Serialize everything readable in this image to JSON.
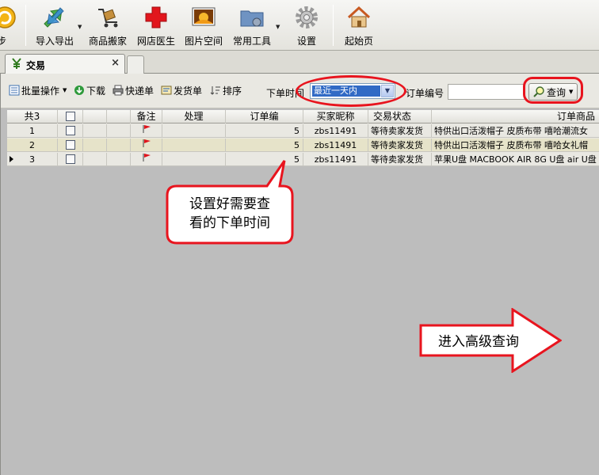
{
  "toolbar": {
    "items": [
      {
        "label": "步",
        "icon": "sync-icon"
      },
      {
        "label": "导入导出",
        "icon": "import-export-icon"
      },
      {
        "label": "商品搬家",
        "icon": "move-goods-icon"
      },
      {
        "label": "网店医生",
        "icon": "shop-doctor-icon"
      },
      {
        "label": "图片空间",
        "icon": "image-space-icon"
      },
      {
        "label": "常用工具",
        "icon": "tools-folder-icon"
      },
      {
        "label": "设置",
        "icon": "settings-gear-icon"
      },
      {
        "label": "起始页",
        "icon": "home-icon"
      }
    ]
  },
  "tabs": {
    "active": {
      "label": "交易",
      "close": "×",
      "icon": "trade-icon"
    }
  },
  "subtoolbar": {
    "batch": "批量操作",
    "download": "下载",
    "express": "快递单",
    "ship": "发货单",
    "sort": "排序",
    "time_label": "下单时间",
    "time_value": "最近一天内",
    "order_no_label": "订单编号",
    "query": "查询"
  },
  "table": {
    "headers": {
      "count": "共3",
      "note": "备注",
      "handle": "处理",
      "order": "订单编",
      "buyer": "买家昵称",
      "status": "交易状态",
      "goods": "订单商品"
    },
    "rows": [
      {
        "num": "1",
        "order_tail": "5",
        "buyer": "zbs11491",
        "status": "等待卖家发货",
        "goods": "特供出口活泼帽子 皮质布带 嘻哈潮流女"
      },
      {
        "num": "2",
        "order_tail": "5",
        "buyer": "zbs11491",
        "status": "等待卖家发货",
        "goods": "特供出口活泼帽子 皮质布带 嘻哈女礼帽"
      },
      {
        "num": "3",
        "order_tail": "5",
        "buyer": "zbs11491",
        "status": "等待卖家发货",
        "goods": "苹果U盘 MACBOOK AIR 8G U盘 air U盘"
      }
    ]
  },
  "annotations": {
    "callout_line1": "设置好需要查",
    "callout_line2": "看的下单时间",
    "arrow_text": "进入高级查询"
  },
  "colors": {
    "highlight": "#e8141e",
    "selection": "#316ac5"
  }
}
